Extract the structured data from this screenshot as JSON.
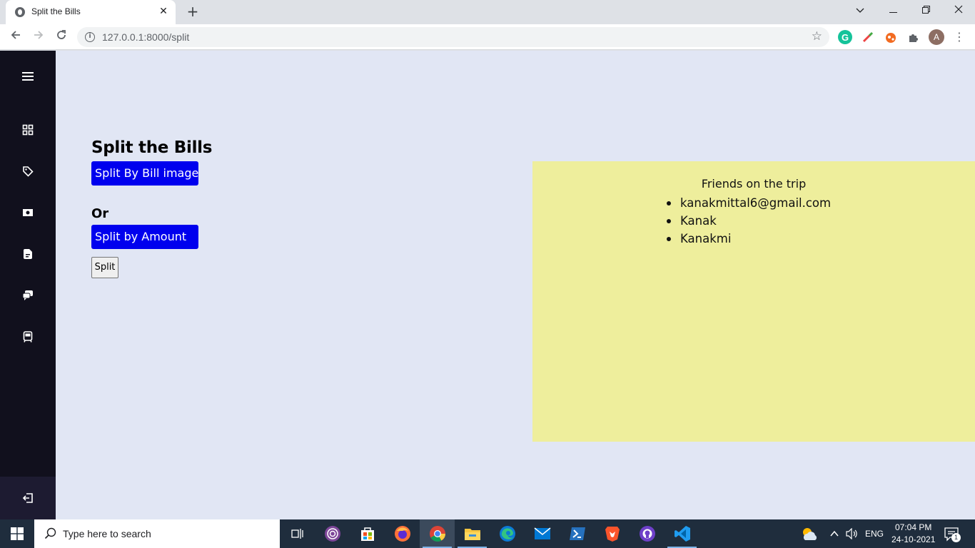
{
  "browser": {
    "tab_title": "Split the Bills",
    "tab_close": "✕",
    "new_tab": "+",
    "window_controls": {
      "tabs_dropdown": "⌄",
      "minimize": "—",
      "restore": "❐",
      "close": "✕"
    },
    "url": "127.0.0.1:8000/split",
    "profile_initial": "A",
    "extension_icons": [
      "grammarly-icon",
      "color-picker-icon",
      "fire-extension-icon",
      "puzzle-extensions-icon"
    ]
  },
  "sidebar": {
    "items": [
      "menu-icon",
      "dashboard-icon",
      "tag-icon",
      "money-icon",
      "bill-icon",
      "chat-icon",
      "receipt-icon",
      "logout-icon"
    ]
  },
  "main": {
    "title": "Split the Bills",
    "split_by_image_label": "Split By Bill image",
    "or_label": "Or",
    "split_by_amount_label": "Split by Amount",
    "split_button_label": "Split"
  },
  "friends": {
    "title": "Friends on the trip",
    "items": [
      "kanakmittal6@gmail.com",
      "Kanak",
      "Kanakmi"
    ]
  },
  "taskbar": {
    "search_placeholder": "Type here to search",
    "language": "ENG",
    "time": "07:04 PM",
    "date": "24-10-2021",
    "notification_count": "1",
    "apps": [
      "task-view-icon",
      "tor-browser-icon",
      "store-icon",
      "firefox-icon",
      "chrome-icon",
      "file-explorer-icon",
      "edge-icon",
      "mail-icon",
      "powershell-icon",
      "brave-icon",
      "github-desktop-icon",
      "vscode-icon"
    ]
  },
  "colors": {
    "sidebar": "#11101d",
    "page_bg": "#e1e6f4",
    "button_blue": "#0000ee",
    "friends_panel": "#eeee9c"
  }
}
